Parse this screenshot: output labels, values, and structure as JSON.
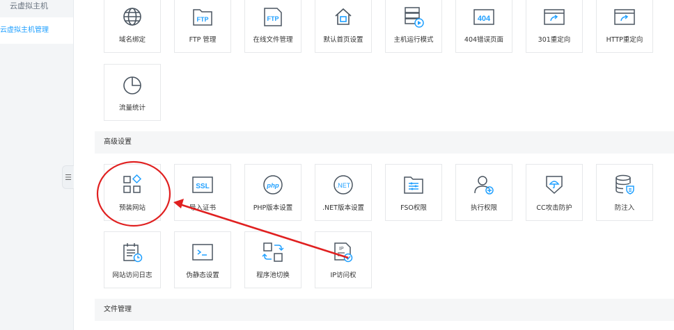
{
  "sidebar": {
    "title": "云虚拟主机",
    "active_item": "云虚拟主机管理",
    "collapse_icon": "☰"
  },
  "row1": [
    {
      "label": "域名绑定",
      "icon": "globe-icon"
    },
    {
      "label": "FTP 管理",
      "icon": "ftp-folder-icon",
      "badge": "FTP"
    },
    {
      "label": "在线文件管理",
      "icon": "ftp-file-icon",
      "badge": "FTP"
    },
    {
      "label": "默认首页设置",
      "icon": "home-icon"
    },
    {
      "label": "主机运行模式",
      "icon": "server-play-icon"
    },
    {
      "label": "404错误页面",
      "icon": "error-404-icon",
      "badge": "404"
    },
    {
      "label": "301重定向",
      "icon": "redirect-icon"
    },
    {
      "label": "HTTP重定向",
      "icon": "http-redirect-icon"
    }
  ],
  "row2": [
    {
      "label": "流量统计",
      "icon": "pie-chart-icon"
    }
  ],
  "section_advanced": "高级设置",
  "row3": [
    {
      "label": "预装网站",
      "icon": "apps-icon"
    },
    {
      "label": "导入证书",
      "icon": "ssl-icon",
      "badge": "SSL"
    },
    {
      "label": "PHP版本设置",
      "icon": "php-icon",
      "badge": "php"
    },
    {
      "label": ".NET版本设置",
      "icon": "dotnet-icon",
      "badge": ".NET"
    },
    {
      "label": "FSO权限",
      "icon": "fso-folder-icon"
    },
    {
      "label": "执行权限",
      "icon": "user-add-icon"
    },
    {
      "label": "CC攻击防护",
      "icon": "umbrella-shield-icon"
    },
    {
      "label": "防注入",
      "icon": "database-shield-icon"
    }
  ],
  "row4": [
    {
      "label": "网站访问日志",
      "icon": "calendar-log-icon"
    },
    {
      "label": "伪静态设置",
      "icon": "terminal-icon"
    },
    {
      "label": "程序池切换",
      "icon": "switch-icon"
    },
    {
      "label": "IP访问权",
      "icon": "ip-file-icon",
      "badge": "IP"
    }
  ],
  "section_files": "文件管理",
  "colors": {
    "accent": "#20a0ff",
    "icon": "#4a5560",
    "annotation": "#e02020"
  }
}
